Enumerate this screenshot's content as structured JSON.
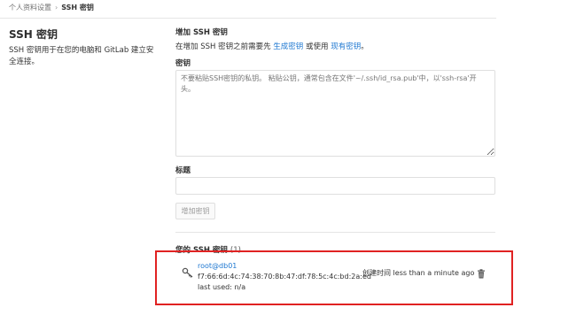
{
  "breadcrumb": {
    "parent": "个人资料设置",
    "separator": "›",
    "current": "SSH 密钥"
  },
  "left": {
    "title": "SSH 密钥",
    "description": "SSH 密钥用于在您的电脑和 GitLab 建立安全连接。"
  },
  "add_section": {
    "title": "增加 SSH 密钥",
    "desc_prefix": "在增加 SSH 密钥之前需要先",
    "generate_link": "生成密钥",
    "desc_middle": "或使用",
    "existing_link": "现有密钥",
    "desc_suffix": "。"
  },
  "key_field": {
    "label": "密钥",
    "placeholder": "不要粘贴SSH密钥的私钥。 粘贴公钥，通常包含在文件'~/.ssh/id_rsa.pub'中，以'ssh-rsa'开头。"
  },
  "title_field": {
    "label": "标题",
    "value": ""
  },
  "add_button": {
    "label": "增加密钥"
  },
  "keys_list": {
    "heading": "您的 SSH 密钥",
    "count": "(1)",
    "items": [
      {
        "icon": "key-icon",
        "name": "root@db01",
        "fingerprint": "f7:66:6d:4c:74:38:70:8b:47:df:78:5c:4c:bd:2a:ed",
        "last_used": "last used: n/a",
        "created_label": "创建时间",
        "created_value": "less than a minute ago",
        "delete_icon": "trash-icon"
      }
    ]
  },
  "colors": {
    "link": "#1f78d1",
    "highlight": "#e02222"
  }
}
